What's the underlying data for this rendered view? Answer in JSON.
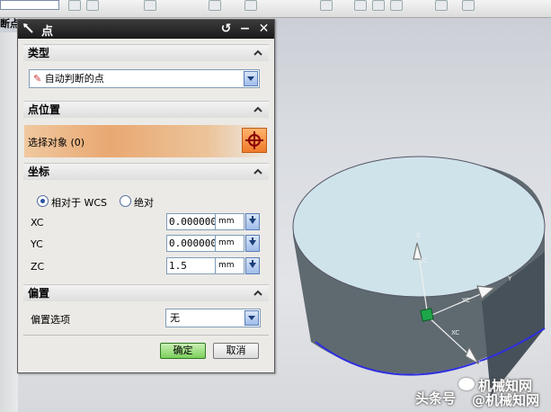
{
  "toolbar": {
    "left_label": "断点"
  },
  "dialog": {
    "title": "点",
    "title_buttons": {
      "reset": "↺",
      "minimize": "−",
      "close": "✕"
    },
    "sections": {
      "type": {
        "header": "类型",
        "dropdown_value": "自动判断的点"
      },
      "point_location": {
        "header": "点位置",
        "select_label": "选择对象 (0)"
      },
      "coordinates": {
        "header": "坐标",
        "radio_relative": "相对于 WCS",
        "radio_absolute": "绝对",
        "selected_radio": "relative",
        "fields": [
          {
            "label": "XC",
            "value": "0.0000000",
            "unit": "mm"
          },
          {
            "label": "YC",
            "value": "0.0000000",
            "unit": "mm"
          },
          {
            "label": "ZC",
            "value": "1.5",
            "unit": "mm"
          }
        ]
      },
      "offset": {
        "header": "偏置",
        "label": "偏置选项",
        "dropdown_value": "无"
      }
    },
    "buttons": {
      "ok": "确定",
      "cancel": "取消"
    }
  },
  "viewport": {
    "axis_labels": {
      "z": "Z",
      "y": "Y",
      "x": "X",
      "zc": "ZC",
      "yc": "YC",
      "xc": "XC"
    },
    "colors": {
      "cylinder_top": "#cfe3ea",
      "cylinder_side": "#5f6a70",
      "edge": "#2e2ee0",
      "point_marker": "#1ea64a"
    }
  },
  "watermark": {
    "brand": "机械知网",
    "source": "头条号",
    "at": "@机械知网"
  }
}
